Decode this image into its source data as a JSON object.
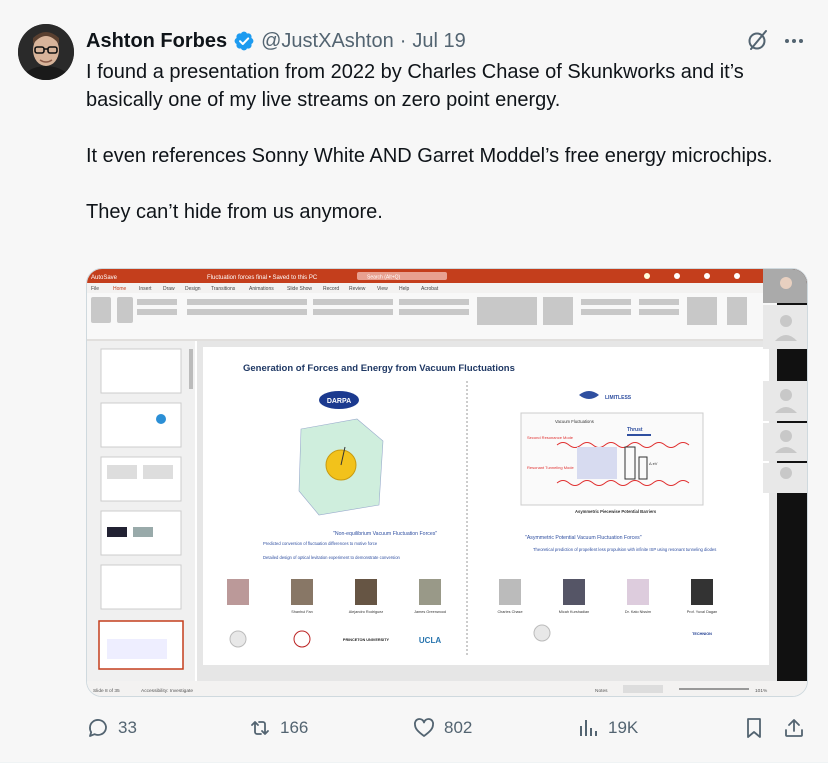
{
  "author": {
    "name": "Ashton Forbes",
    "handle": "@JustXAshton",
    "separator": "·",
    "date": "Jul 19"
  },
  "tweet": {
    "paragraphs": [
      "I found a presentation from 2022 by Charles Chase of Skunkworks and it’s basically one of my live streams on zero point energy.",
      "It even references Sonny White AND Garret Moddel’s free energy microchips.",
      "They can’t hide from us anymore."
    ]
  },
  "media": {
    "app": "PowerPoint",
    "file_title": "Fluctuation forces final • Saved to this PC",
    "search_placeholder": "Search (Alt+Q)",
    "ribbon_tabs": [
      "File",
      "Home",
      "Insert",
      "Draw",
      "Design",
      "Transitions",
      "Animations",
      "Slide Show",
      "Record",
      "Review",
      "View",
      "Help",
      "Acrobat"
    ],
    "slide": {
      "title": "Generation of Forces and Energy from Vacuum Fluctuations",
      "left_logo": "DARPA",
      "right_logo": "LIMITLESS",
      "left_caption": "\"Non-equilibrium Vacuum Fluctuation Forces\"",
      "left_bullets": [
        "Predicted conversion of fluctuation differences to motive force",
        "Detailed design of optical levitation experiment to demonstrate conversion"
      ],
      "right_caption": "\"Asymmetric Potential Vacuum Fluctuation Forces\"",
      "right_bullets": [
        "Theoretical prediction of propellent less propulsion with infinite ISP using resonant tunneling diodes"
      ],
      "diagram_labels": {
        "top": "Vacuum Fluctuations",
        "thrust": "Thrust",
        "second": "Second Resonance Mode",
        "resonant": "Resonant Tunneling Mode",
        "ev": "Δ eV",
        "bottom": "Asymmetric Piecewise Potential Barriers"
      },
      "left_people": [
        "",
        "Shanhui Fan",
        "Alejandro Rodriguez",
        "James Greenwood"
      ],
      "right_people": [
        "Charles Chase",
        "Micah Kurshadian",
        "Dr. Kato Nissim",
        "Prof. Yuval Dagan"
      ],
      "left_institutions": [
        "",
        "",
        "PRINCETON UNIVERSITY",
        "UCLA"
      ],
      "right_institutions": [
        "",
        "TECHNION"
      ]
    },
    "status_bar": {
      "slide_info": "Slide 8 of 35",
      "accessibility": "Accessibility: Investigate",
      "notes": "Notes",
      "zoom": "101%"
    },
    "thumbnails_count": 6
  },
  "stats": {
    "replies": "33",
    "reposts": "166",
    "likes": "802",
    "views": "19K"
  },
  "colors": {
    "text": "#0f1419",
    "secondary": "#536471",
    "verified": "#1d9bf0",
    "ppt_red": "#c43e1c",
    "slide_red": "#e03030",
    "slide_blue": "#2f4fa0"
  }
}
